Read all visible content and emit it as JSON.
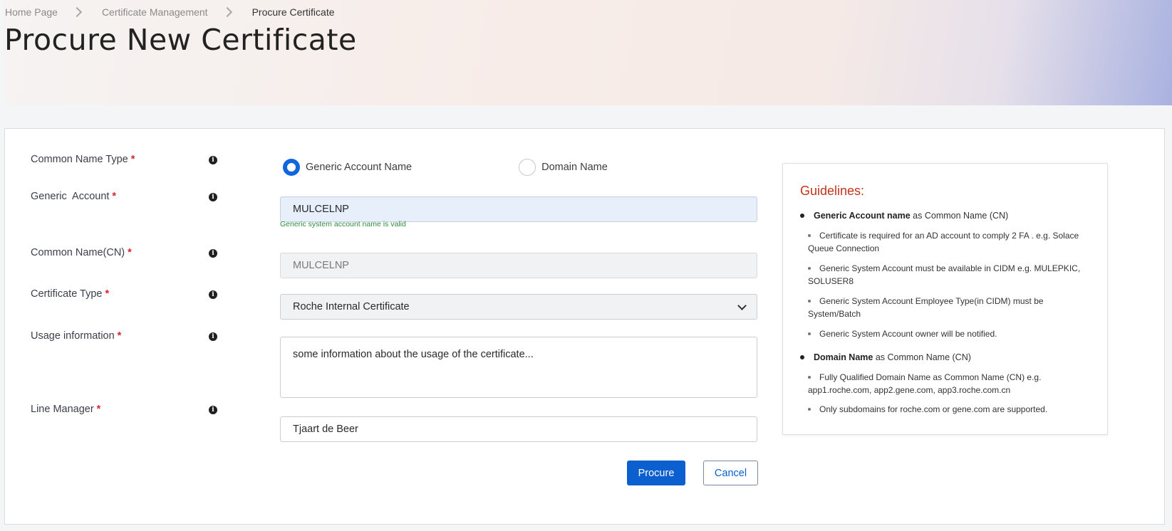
{
  "breadcrumb": {
    "items": [
      "Home Page",
      "Certificate Management",
      "Procure Certificate"
    ]
  },
  "page_title": "Procure New Certificate",
  "form": {
    "common_name_type": {
      "label": "Common Name Type",
      "options": [
        "Generic Account Name",
        "Domain Name"
      ],
      "selected": "Generic Account Name"
    },
    "generic_account": {
      "label": "Generic  Account",
      "value": "MULCELNP",
      "validation": "Generic system account name is valid"
    },
    "common_name": {
      "label": "Common Name(CN)",
      "value": "MULCELNP"
    },
    "certificate_type": {
      "label": "Certificate Type",
      "value": "Roche Internal Certificate"
    },
    "usage_information": {
      "label": "Usage information",
      "value": "some information about the usage of the certificate..."
    },
    "line_manager": {
      "label": "Line Manager",
      "value": "Tjaart de Beer"
    },
    "required_marker": "*",
    "procure_label": "Procure",
    "cancel_label": "Cancel"
  },
  "guidelines": {
    "title": "Guidelines:",
    "generic": {
      "bold": "Generic Account name",
      "rest": " as Common Name (CN)",
      "items": [
        "Certificate is required for an AD account to comply 2 FA . e.g. Solace Queue Connection",
        "Generic System Account must be available in CIDM e.g. MULEPKIC, SOLUSER8",
        "Generic System Account Employee Type(in CIDM) must be System/Batch",
        "Generic System Account owner will be notified."
      ]
    },
    "domain": {
      "bold": "Domain Name",
      "rest": " as Common Name (CN)",
      "items": [
        "Fully Qualified Domain Name as Common Name (CN) e.g. app1.roche.com, app2.gene.com, app3.roche.com.cn",
        "Only subdomains for roche.com or gene.com are supported."
      ]
    }
  },
  "colors": {
    "primary": "#0b5fce",
    "required": "#d6262a",
    "guidelines_title": "#c2331c",
    "valid": "#2e8b3e"
  }
}
